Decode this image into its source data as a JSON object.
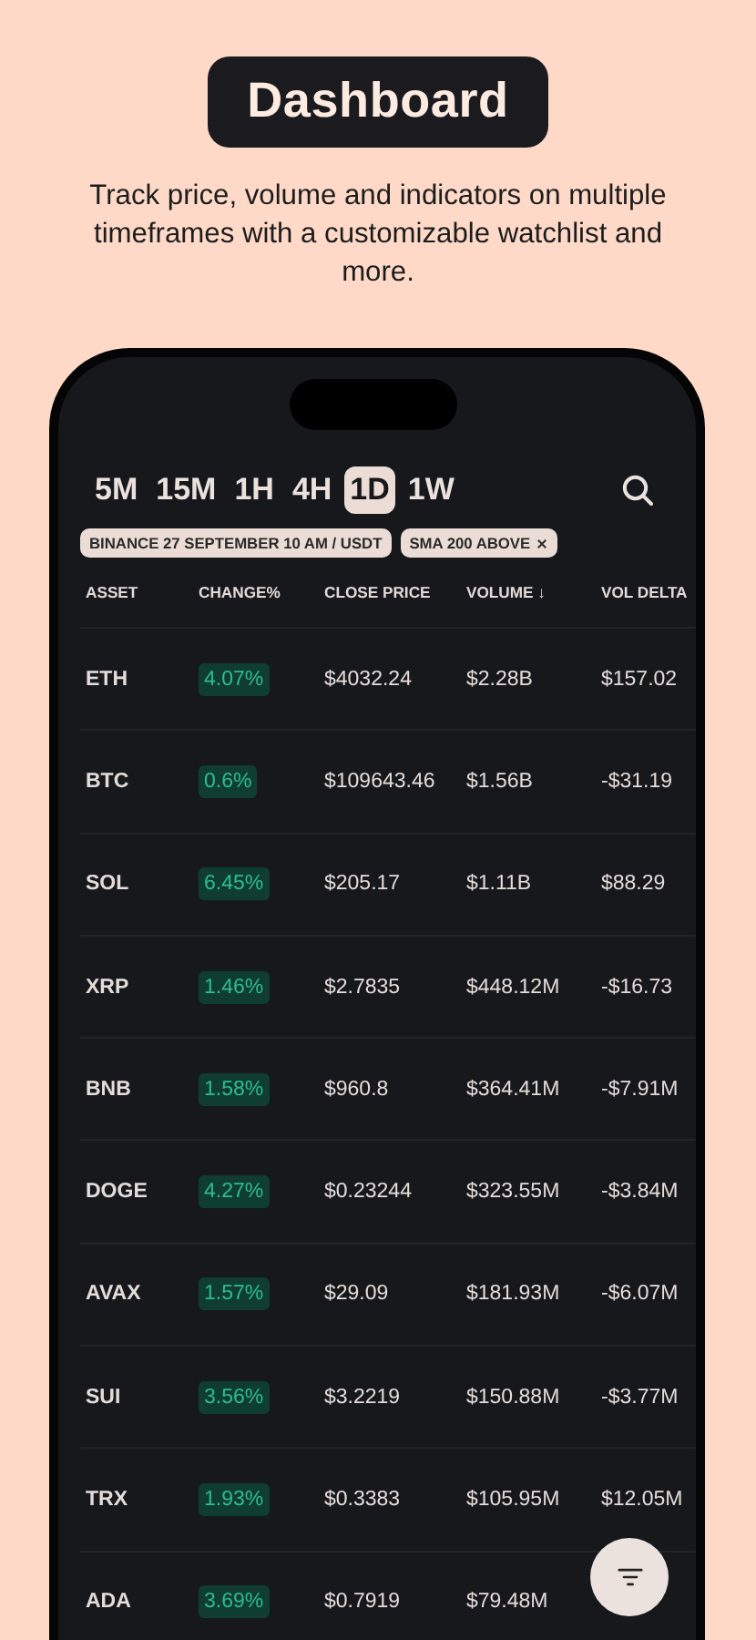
{
  "header": {
    "title": "Dashboard",
    "subtitle": "Track price, volume and indicators on multiple timeframes with a customizable watchlist and more."
  },
  "timeframes": [
    {
      "label": "5M",
      "selected": false
    },
    {
      "label": "15M",
      "selected": false
    },
    {
      "label": "1H",
      "selected": false
    },
    {
      "label": "4H",
      "selected": false
    },
    {
      "label": "1D",
      "selected": true
    },
    {
      "label": "1W",
      "selected": false
    }
  ],
  "filters": [
    {
      "label": "BINANCE 27 SEPTEMBER 10 AM / USDT",
      "removable": false
    },
    {
      "label": "SMA 200 ABOVE",
      "removable": true
    }
  ],
  "table": {
    "columns": [
      "ASSET",
      "CHANGE%",
      "CLOSE PRICE",
      "VOLUME ↓",
      "VOL DELTA"
    ],
    "rows": [
      {
        "asset": "ETH",
        "change": "4.07%",
        "close": "$4032.24",
        "volume": "$2.28B",
        "vol_delta": "$157.02"
      },
      {
        "asset": "BTC",
        "change": "0.6%",
        "close": "$109643.46",
        "volume": "$1.56B",
        "vol_delta": "-$31.19"
      },
      {
        "asset": "SOL",
        "change": "6.45%",
        "close": "$205.17",
        "volume": "$1.11B",
        "vol_delta": "$88.29"
      },
      {
        "asset": "XRP",
        "change": "1.46%",
        "close": "$2.7835",
        "volume": "$448.12M",
        "vol_delta": "-$16.73"
      },
      {
        "asset": "BNB",
        "change": "1.58%",
        "close": "$960.8",
        "volume": "$364.41M",
        "vol_delta": "-$7.91M"
      },
      {
        "asset": "DOGE",
        "change": "4.27%",
        "close": "$0.23244",
        "volume": "$323.55M",
        "vol_delta": "-$3.84M"
      },
      {
        "asset": "AVAX",
        "change": "1.57%",
        "close": "$29.09",
        "volume": "$181.93M",
        "vol_delta": "-$6.07M"
      },
      {
        "asset": "SUI",
        "change": "3.56%",
        "close": "$3.2219",
        "volume": "$150.88M",
        "vol_delta": "-$3.77M"
      },
      {
        "asset": "TRX",
        "change": "1.93%",
        "close": "$0.3383",
        "volume": "$105.95M",
        "vol_delta": "$12.05M"
      },
      {
        "asset": "ADA",
        "change": "3.69%",
        "close": "$0.7919",
        "volume": "$79.48M"
      }
    ]
  }
}
